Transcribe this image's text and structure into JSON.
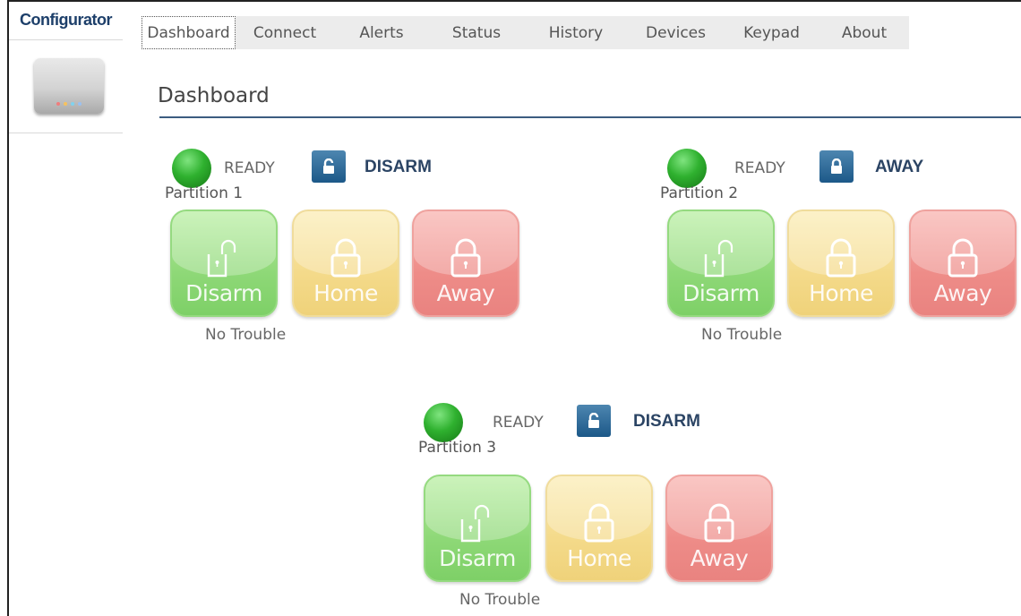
{
  "sidebar": {
    "title": "Configurator"
  },
  "tabs": [
    "Dashboard",
    "Connect",
    "Alerts",
    "Status",
    "History",
    "Devices",
    "Keypad",
    "About"
  ],
  "page": {
    "title": "Dashboard"
  },
  "partitions": [
    {
      "name": "Partition 1",
      "ready": "READY",
      "mode": "DISARM",
      "lock": "unlocked",
      "trouble": "No Trouble",
      "buttons": [
        "Disarm",
        "Home",
        "Away"
      ]
    },
    {
      "name": "Partition 2",
      "ready": "READY",
      "mode": "AWAY",
      "lock": "locked",
      "trouble": "No Trouble",
      "buttons": [
        "Disarm",
        "Home",
        "Away"
      ]
    },
    {
      "name": "Partition 3",
      "ready": "READY",
      "mode": "DISARM",
      "lock": "unlocked",
      "trouble": "No Trouble",
      "buttons": [
        "Disarm",
        "Home",
        "Away"
      ]
    }
  ],
  "colors": {
    "accent": "#1c5888",
    "ready_led": "#2fb12f",
    "disarm": "#8ed877",
    "home": "#f4da8a",
    "away": "#ee8c88"
  },
  "icons": {
    "disarm": "open-lock-icon",
    "home": "lock-icon",
    "away": "lock-icon",
    "device": "panel-device-icon"
  }
}
